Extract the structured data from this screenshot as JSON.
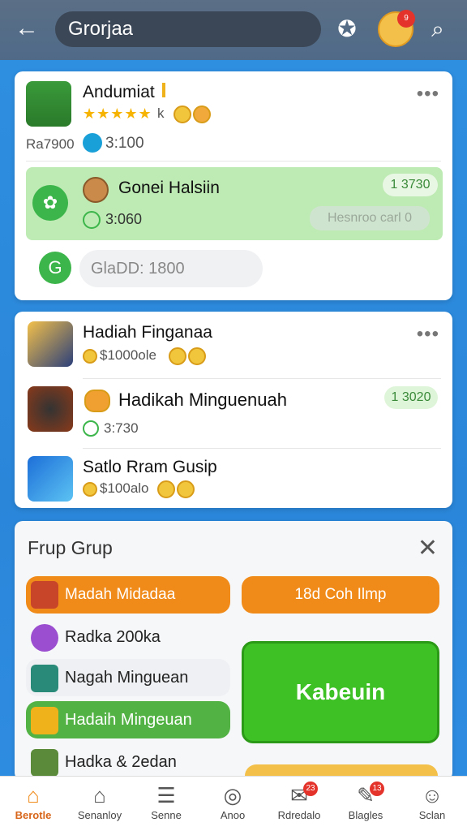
{
  "header": {
    "search_text": "Grorjaa",
    "mascot_badge": "9"
  },
  "card1": {
    "user": {
      "name": "Andumiat",
      "rating_stars": "★★★★★",
      "extra": "k"
    },
    "left_label": "Ra7900",
    "left_value": "3:100",
    "green_row": {
      "title": "Gonei Halsiin",
      "time": "3:060",
      "badge": "1 3730",
      "placeholder": "Hesnroo carl 0"
    },
    "grey_pill": "GlaDD: 1800"
  },
  "card2": {
    "items": [
      {
        "title": "Hadiah Finganaa",
        "sub": "$1000ole"
      },
      {
        "title": "Hadikah Minguenuah",
        "sub": "3:730",
        "badge": "1 3020"
      },
      {
        "title": "Satlo Rram Gusip",
        "sub": "$100alo"
      }
    ]
  },
  "sheet": {
    "title": "Frup Grup",
    "close": "✕",
    "left_items": [
      {
        "label": "Madah Midadaa"
      },
      {
        "label": "Radka 200ka"
      },
      {
        "label": "Nagah Minguean"
      },
      {
        "label": "Hadaih Mingeuan"
      },
      {
        "label": "Hadka & 2edan"
      }
    ],
    "orange_button": "18d Coh Ilmp",
    "green_button": "Kabeuin"
  },
  "tabbar": [
    {
      "label": "Berotle",
      "icon": "home-icon",
      "active": true
    },
    {
      "label": "Senanloy",
      "icon": "house-outline-icon"
    },
    {
      "label": "Senne",
      "icon": "list-icon"
    },
    {
      "label": "Anoo",
      "icon": "target-icon"
    },
    {
      "label": "Rdredalo",
      "icon": "mail-icon",
      "badge": "23"
    },
    {
      "label": "Blagles",
      "icon": "edit-icon",
      "badge": "13"
    },
    {
      "label": "Sclan",
      "icon": "people-icon"
    }
  ],
  "colors": {
    "accent_green": "#3cb54a",
    "accent_orange": "#f08b1a",
    "header_bg": "#55708c"
  }
}
